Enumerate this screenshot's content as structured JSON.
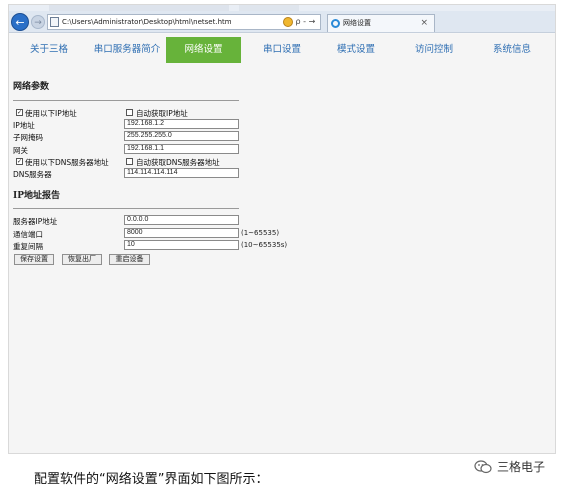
{
  "browser": {
    "address": "C:\\Users\\Administrator\\Desktop\\html\\netset.htm",
    "address_tools": "ρ - →",
    "tab_title": "网络设置",
    "tab_close": "×",
    "back_glyph": "←",
    "forward_glyph": "→"
  },
  "menu": {
    "items": [
      {
        "label": "关于三格"
      },
      {
        "label": "串口服务器简介"
      },
      {
        "label": "网络设置"
      },
      {
        "label": "串口设置"
      },
      {
        "label": "模式设置"
      },
      {
        "label": "访问控制"
      },
      {
        "label": "系统信息"
      }
    ],
    "active_index": 2,
    "active_color": "#67b33a",
    "link_color": "#2f6fb3"
  },
  "network": {
    "title": "网络参数",
    "use_ip_label": "使用以下IP地址",
    "use_ip_checked": true,
    "auto_ip_label": "自动获取IP地址",
    "auto_ip_checked": false,
    "ip_label": "IP地址",
    "ip_value": "192.168.1.2",
    "mask_label": "子网掩码",
    "mask_value": "255.255.255.0",
    "gateway_label": "网关",
    "gateway_value": "192.168.1.1",
    "use_dns_label": "使用以下DNS服务器地址",
    "use_dns_checked": true,
    "auto_dns_label": "自动获取DNS服务器地址",
    "auto_dns_checked": false,
    "dns_label": "DNS服务器",
    "dns_value": "114.114.114.114"
  },
  "ip_report": {
    "title": "IP地址报告",
    "server_ip_label": "服务器IP地址",
    "server_ip_value": "0.0.0.0",
    "port_label": "通信端口",
    "port_value": "8000",
    "port_hint": "(1~65535)",
    "interval_label": "重复间隔",
    "interval_value": "10",
    "interval_hint": "(10~65535s)"
  },
  "buttons": {
    "save": "保存设置",
    "restore": "恢复出厂",
    "restart": "重启设备"
  },
  "caption": "配置软件的“网络设置”界面如下图所示：",
  "brand": "三格电子"
}
